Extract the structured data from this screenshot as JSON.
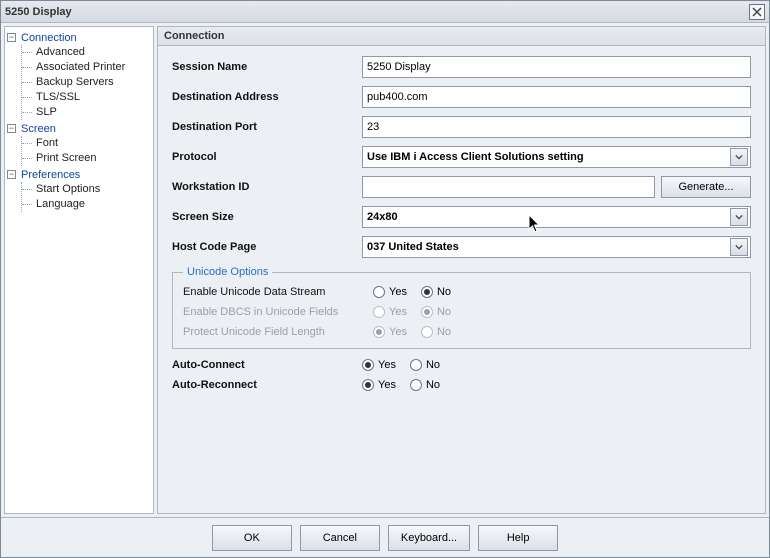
{
  "window": {
    "title": "5250 Display"
  },
  "tree": {
    "connection": {
      "label": "Connection",
      "children": {
        "advanced": "Advanced",
        "associated_printer": "Associated Printer",
        "backup_servers": "Backup Servers",
        "tls_ssl": "TLS/SSL",
        "slp": "SLP"
      }
    },
    "screen": {
      "label": "Screen",
      "children": {
        "font": "Font",
        "print_screen": "Print Screen"
      }
    },
    "preferences": {
      "label": "Preferences",
      "children": {
        "start_options": "Start Options",
        "language": "Language"
      }
    }
  },
  "panel": {
    "header": "Connection",
    "session_name": {
      "label": "Session Name",
      "value": "5250 Display"
    },
    "dest_addr": {
      "label": "Destination Address",
      "value": "pub400.com"
    },
    "dest_port": {
      "label": "Destination Port",
      "value": "23"
    },
    "protocol": {
      "label": "Protocol",
      "value": "Use IBM i Access Client Solutions setting"
    },
    "workstation": {
      "label": "Workstation ID",
      "value": ""
    },
    "generate_label": "Generate...",
    "screen_size": {
      "label": "Screen Size",
      "value": "24x80"
    },
    "host_code_page": {
      "label": "Host Code Page",
      "value": "037 United States"
    },
    "unicode": {
      "legend": "Unicode Options",
      "enable_stream": {
        "label": "Enable Unicode Data Stream",
        "value": "No"
      },
      "enable_dbcs": {
        "label": "Enable DBCS in Unicode Fields",
        "value": "No"
      },
      "protect_len": {
        "label": "Protect Unicode Field Length",
        "value": "Yes"
      }
    },
    "auto_connect": {
      "label": "Auto-Connect",
      "value": "Yes"
    },
    "auto_reconnect": {
      "label": "Auto-Reconnect",
      "value": "Yes"
    },
    "yes": "Yes",
    "no": "No",
    "tree_toggle": "−"
  },
  "footer": {
    "ok": "OK",
    "cancel": "Cancel",
    "keyboard": "Keyboard...",
    "help": "Help"
  }
}
